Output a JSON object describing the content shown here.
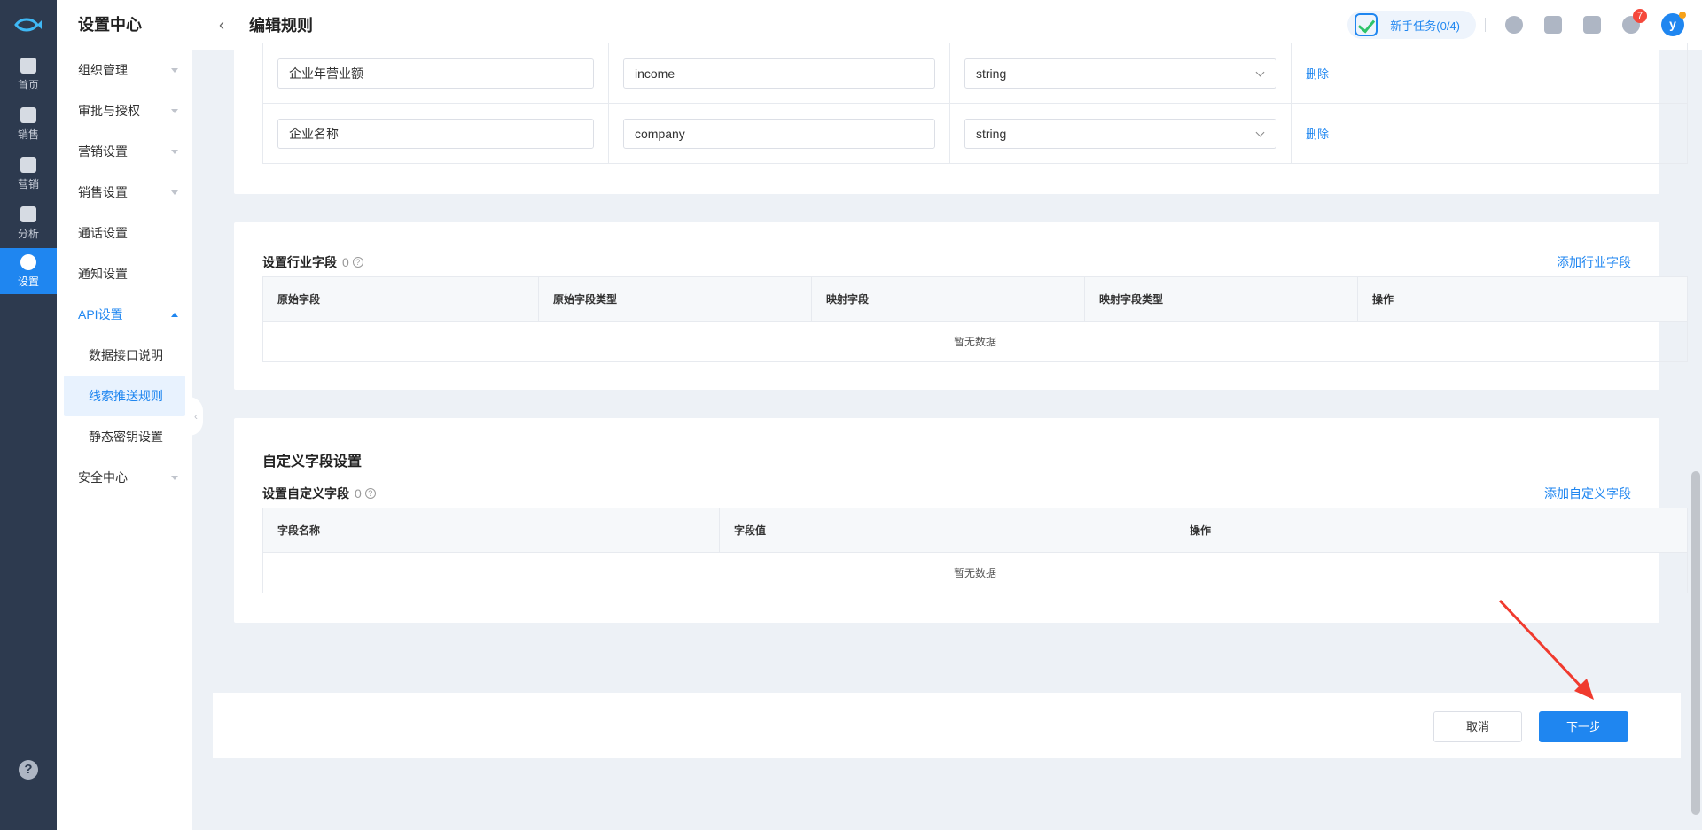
{
  "rail": {
    "items": [
      {
        "label": "首页"
      },
      {
        "label": "销售"
      },
      {
        "label": "营销"
      },
      {
        "label": "分析"
      },
      {
        "label": "设置"
      }
    ],
    "help": "?"
  },
  "sidebar": {
    "title": "设置中心",
    "items": [
      {
        "label": "组织管理"
      },
      {
        "label": "审批与授权"
      },
      {
        "label": "营销设置"
      },
      {
        "label": "销售设置"
      },
      {
        "label": "通话设置"
      },
      {
        "label": "通知设置"
      },
      {
        "label": "API设置"
      },
      {
        "label": "安全中心"
      }
    ],
    "api_sub": [
      {
        "label": "数据接口说明"
      },
      {
        "label": "线索推送规则"
      },
      {
        "label": "静态密钥设置"
      }
    ]
  },
  "header": {
    "back": "‹",
    "title": "编辑规则",
    "task": "新手任务(0/4)",
    "notification_count": "7",
    "avatar": "y"
  },
  "field_rows": [
    {
      "source": "企业年营业额",
      "mapped": "income",
      "type": "string",
      "action": "删除"
    },
    {
      "source": "企业名称",
      "mapped": "company",
      "type": "string",
      "action": "删除"
    }
  ],
  "industry": {
    "label": "设置行业字段",
    "count": "0",
    "add_link": "添加行业字段",
    "columns": [
      "原始字段",
      "原始字段类型",
      "映射字段",
      "映射字段类型",
      "操作"
    ],
    "empty": "暂无数据"
  },
  "custom": {
    "heading": "自定义字段设置",
    "label": "设置自定义字段",
    "count": "0",
    "add_link": "添加自定义字段",
    "columns": [
      "字段名称",
      "字段值",
      "操作"
    ],
    "empty": "暂无数据"
  },
  "footer": {
    "cancel": "取消",
    "next": "下一步"
  },
  "colors": {
    "primary": "#1f86f0",
    "rail_bg": "#2d3a4f",
    "badge": "#f5483b",
    "annotation_arrow": "#f03a2e"
  }
}
